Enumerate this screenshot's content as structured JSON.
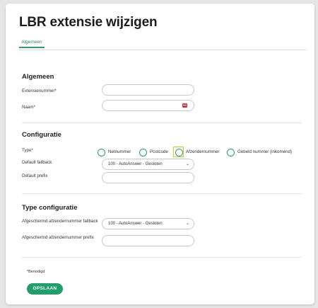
{
  "page": {
    "title": "LBR extensie wijzigen"
  },
  "tabs": [
    {
      "label": "Algemeen",
      "active": true
    }
  ],
  "sections": {
    "algemeen": {
      "title": "Algemeen",
      "fields": {
        "extensienummer": {
          "label": "Extensienummer*",
          "value": ""
        },
        "naam": {
          "label": "Naam*",
          "value": ""
        }
      }
    },
    "configuratie": {
      "title": "Configuratie",
      "type": {
        "label": "Type*",
        "options": [
          "Netnummer",
          "Postcode",
          "Afzendernummer",
          "Gebeld nummer (inkomend)"
        ]
      },
      "default_fallback": {
        "label": "Default fallback",
        "value": "100 - AutoAnswer - Gesloten"
      },
      "default_prefix": {
        "label": "Default prefix",
        "value": ""
      }
    },
    "type_configuratie": {
      "title": "Type configuratie",
      "afgeschermd_fallback": {
        "label": "Afgeschermd afzendernummer fallback",
        "value": "100 - AutoAnswer - Gesloten"
      },
      "afgeschermd_prefix": {
        "label": "Afgeschermd afzendernummer prefix",
        "value": ""
      }
    }
  },
  "footer": {
    "required_note": "*Benodigd",
    "save_label": "OPSLAAN"
  },
  "colors": {
    "accent": "#1fa06a",
    "highlight": "#b9d51c"
  }
}
